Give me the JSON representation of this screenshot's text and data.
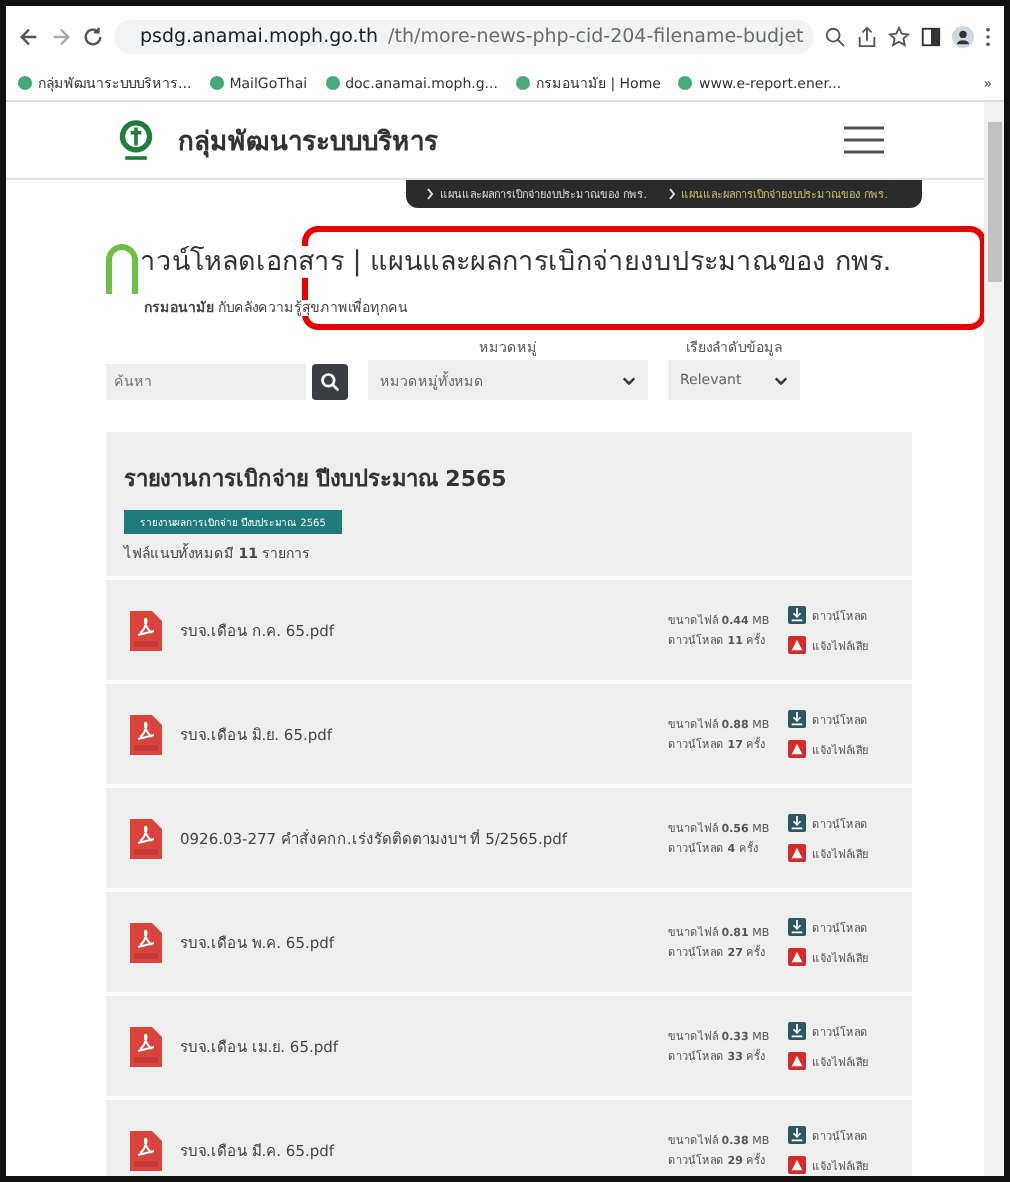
{
  "browser": {
    "url_host": "psdg.anamai.moph.go.th",
    "url_path": "/th/more-news-php-cid-204-filename-budjet",
    "bookmarks": [
      "กลุ่มพัฒนาระบบบริหาร...",
      "MailGoThai",
      "doc.anamai.moph.g...",
      "กรมอนามัย | Home",
      "www.e-report.ener..."
    ],
    "more": "»"
  },
  "site": {
    "name": "กลุ่มพัฒนาระบบบริหาร"
  },
  "breadcrumb": [
    "แผนและผลการเบิกจ่ายงบประมาณของ กพร.",
    "แผนและผลการเบิกจ่ายงบประมาณของ กพร."
  ],
  "heading": {
    "title": "าวน์โหลดเอกสาร | แผนและผลการเบิกจ่ายงบประมาณของ กพร.",
    "subtitle": "**กรมอนามัย** กับคลังความรู้สุขภาพเพื่อทุกคน"
  },
  "filters": {
    "search_placeholder": "ค้นหา",
    "category_label": "หมวดหมู่",
    "category_value": "หมวดหมู่ทั้งหมด",
    "sort_label": "เรียงลำดับข้อมูล",
    "sort_value": "Relevant"
  },
  "section": {
    "title": "รายงานการเบิกจ่าย ปีงบประมาณ 2565",
    "tag": "รายงานผลการเบิกจ่าย ปีงบประมาณ 2565",
    "count": "ไฟล์แนบทั้งหมดมี **11** รายการ"
  },
  "files": [
    {
      "name": "รบจ.เดือน ก.ค. 65.pdf",
      "size": "ขนาดไฟล์ **0.44** MB",
      "downloads": "ดาวน์โหลด **11** ครั้ง",
      "download": "ดาวน์โหลด",
      "report": "แจ้งไฟล์เสีย"
    },
    {
      "name": "รบจ.เดือน มิ.ย. 65.pdf",
      "size": "ขนาดไฟล์ **0.88** MB",
      "downloads": "ดาวน์โหลด **17** ครั้ง",
      "download": "ดาวน์โหลด",
      "report": "แจ้งไฟล์เสีย"
    },
    {
      "name": "0926.03-277 คำสั่งคกก.เร่งรัดติดตามงบฯ ที่ 5/2565.pdf",
      "size": "ขนาดไฟล์ **0.56** MB",
      "downloads": "ดาวน์โหลด **4** ครั้ง",
      "download": "ดาวน์โหลด",
      "report": "แจ้งไฟล์เสีย"
    },
    {
      "name": "รบจ.เดือน พ.ค. 65.pdf",
      "size": "ขนาดไฟล์ **0.81** MB",
      "downloads": "ดาวน์โหลด **27** ครั้ง",
      "download": "ดาวน์โหลด",
      "report": "แจ้งไฟล์เสีย"
    },
    {
      "name": "รบจ.เดือน เม.ย. 65.pdf",
      "size": "ขนาดไฟล์ **0.33** MB",
      "downloads": "ดาวน์โหลด **33** ครั้ง",
      "download": "ดาวน์โหลด",
      "report": "แจ้งไฟล์เสีย"
    },
    {
      "name": "รบจ.เดือน มี.ค. 65.pdf",
      "size": "ขนาดไฟล์ **0.38** MB",
      "downloads": "ดาวน์โหลด **29** ครั้ง",
      "download": "ดาวน์โหลด",
      "report": "แจ้งไฟล์เสีย"
    }
  ]
}
